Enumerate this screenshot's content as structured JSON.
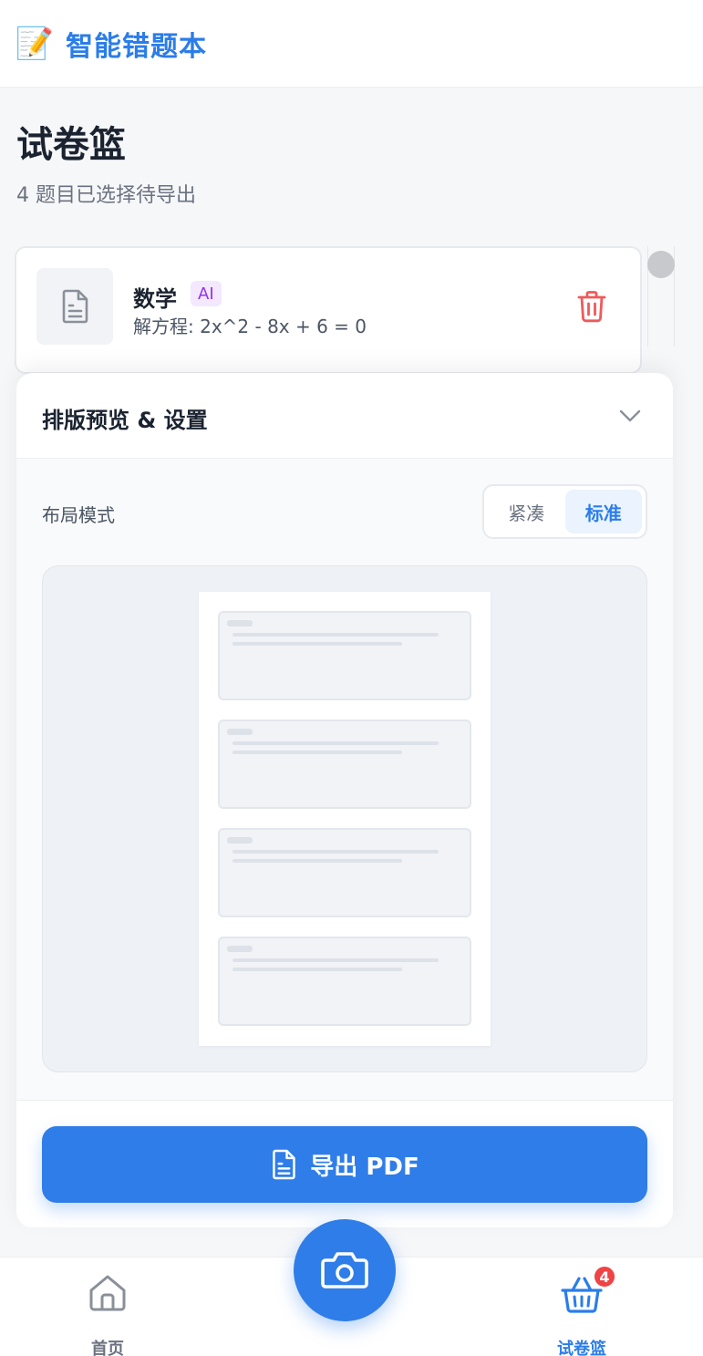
{
  "header": {
    "logo_icon": "memo-pencil-icon",
    "title": "智能错题本"
  },
  "page": {
    "title": "试卷篮",
    "subtitle": "4 题目已选择待导出"
  },
  "question": {
    "subject": "数学",
    "badge": "AI",
    "text": "解方程: 2x^2 - 8x + 6 = 0",
    "thumb_icon": "document-icon",
    "delete_icon": "trash-icon"
  },
  "panel": {
    "title": "排版预览 & 设置",
    "layout_label": "布局模式",
    "layout_options": [
      "紧凑",
      "标准"
    ],
    "layout_selected": "标准",
    "export_label": "导出 PDF"
  },
  "nav": {
    "home_label": "首页",
    "basket_label": "试卷篮",
    "basket_count": "4",
    "camera_icon": "camera-icon"
  },
  "colors": {
    "accent": "#2f7de8",
    "danger": "#ef4444",
    "badge_ai": "#9333ea"
  }
}
